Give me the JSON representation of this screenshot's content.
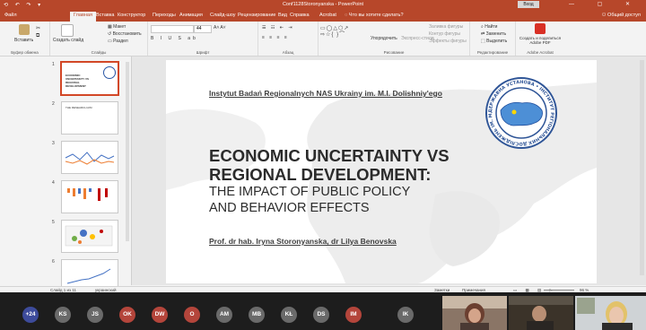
{
  "app": {
    "quick_access": "⟲ ↶ ↷ ▾",
    "document_title": "Conf1128Storonyanska - PowerPoint",
    "signin_label": "Вход",
    "window_controls": "—  ▢  ✕"
  },
  "tabs": [
    "Файл",
    "Главная",
    "Вставка",
    "Конструктор",
    "Переходы",
    "Анимация",
    "Слайд-шоу",
    "Рецензирование",
    "Вид",
    "Справка",
    "Acrobat",
    "Что вы хотите сделать?"
  ],
  "share_label": "Общий доступ",
  "ribbon": {
    "paste": "Вставить",
    "new_slide": "Создать слайд",
    "layout": "Макет",
    "reset": "Восстановить",
    "section": "Раздел",
    "font_size": "44",
    "arrange": "Упорядочить",
    "express_styles": "Экспресс-стили",
    "shape_fill": "Заливка фигуры",
    "shape_outline": "Контур фигуры",
    "shape_effects": "Эффекты фигуры",
    "find": "Найти",
    "replace": "Заменить",
    "select": "Выделить",
    "create_pdf": "Создать и поделиться Adobe PDF",
    "groups": {
      "clipboard": "Буфер обмена",
      "slides": "Слайды",
      "font": "Шрифт",
      "paragraph": "Абзац",
      "drawing": "Рисование",
      "editing": "Редактирование",
      "acrobat": "Adobe Acrobat"
    }
  },
  "thumbnails": [
    {
      "num": "1",
      "caption": "ECONOMIC UNCERTAINTY VS REGIONAL DEVELOPMENT"
    },
    {
      "num": "2",
      "caption": "THE RESEARCH AIM"
    },
    {
      "num": "3",
      "caption": ""
    },
    {
      "num": "4",
      "caption": ""
    },
    {
      "num": "5",
      "caption": ""
    },
    {
      "num": "6",
      "caption": ""
    }
  ],
  "slide": {
    "institute": "Instytut Badań Regionalnych NAS Ukrainy im. M.I. Dolishniy'ego",
    "title_line1": "ECONOMIC UNCERTAINTY VS",
    "title_line2": "REGIONAL DEVELOPMENT:",
    "subtitle_line1": "THE IMPACT OF PUBLIC POLICY",
    "subtitle_line2": "AND BEHAVIOR EFFECTS",
    "authors": "Prof. dr hab. Iryna Storonyanska, dr Lilya Benovska",
    "seal_text": "ДЕРЖАВНА УСТАНОВА • ІНСТИТУТ РЕГІОНАЛЬНИХ ДОСЛІДЖЕНЬ ІМ. М.І. ДОЛІШНЬОГО НАН УКРАЇНИ •"
  },
  "status": {
    "slide_count": "Слайд 1 из 11",
    "language": "украинский",
    "notes": "Заметки",
    "comments": "Примечания",
    "zoom": "96 %"
  },
  "participants": [
    {
      "initials": "+24",
      "color": "#3d4b9b"
    },
    {
      "initials": "KS",
      "color": "#6a6a6a"
    },
    {
      "initials": "JS",
      "color": "#6a6a6a"
    },
    {
      "initials": "OK",
      "color": "#b4453b"
    },
    {
      "initials": "DW",
      "color": "#b4453b"
    },
    {
      "initials": "O",
      "color": "#b4453b"
    },
    {
      "initials": "AM",
      "color": "#6a6a6a"
    },
    {
      "initials": "MB",
      "color": "#6a6a6a"
    },
    {
      "initials": "KŁ",
      "color": "#6a6a6a"
    },
    {
      "initials": "DS",
      "color": "#6a6a6a"
    },
    {
      "initials": "IM",
      "color": "#b4453b"
    },
    {
      "initials": "IK",
      "color": "#6a6a6a"
    }
  ]
}
